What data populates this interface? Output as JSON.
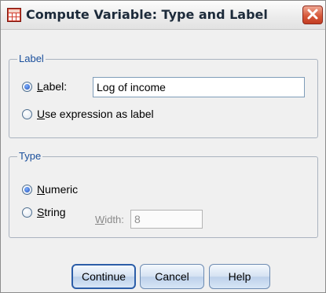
{
  "window": {
    "title": "Compute Variable: Type and Label",
    "app_icon": "spss-grid-icon",
    "close_icon": "close-icon"
  },
  "label_group": {
    "title": "Label",
    "label_option": {
      "prefix": "",
      "accel": "L",
      "rest": "abel:",
      "checked": true
    },
    "label_value": "Log of income",
    "expression_option": {
      "accel": "U",
      "rest": "se expression as label",
      "checked": false
    }
  },
  "type_group": {
    "title": "Type",
    "numeric_option": {
      "accel": "N",
      "rest": "umeric",
      "checked": true
    },
    "string_option": {
      "accel": "S",
      "rest": "tring",
      "checked": false
    },
    "width_label": {
      "accel": "W",
      "rest": "idth:"
    },
    "width_value": "8"
  },
  "buttons": {
    "continue": "Continue",
    "cancel": "Cancel",
    "help": "Help"
  }
}
